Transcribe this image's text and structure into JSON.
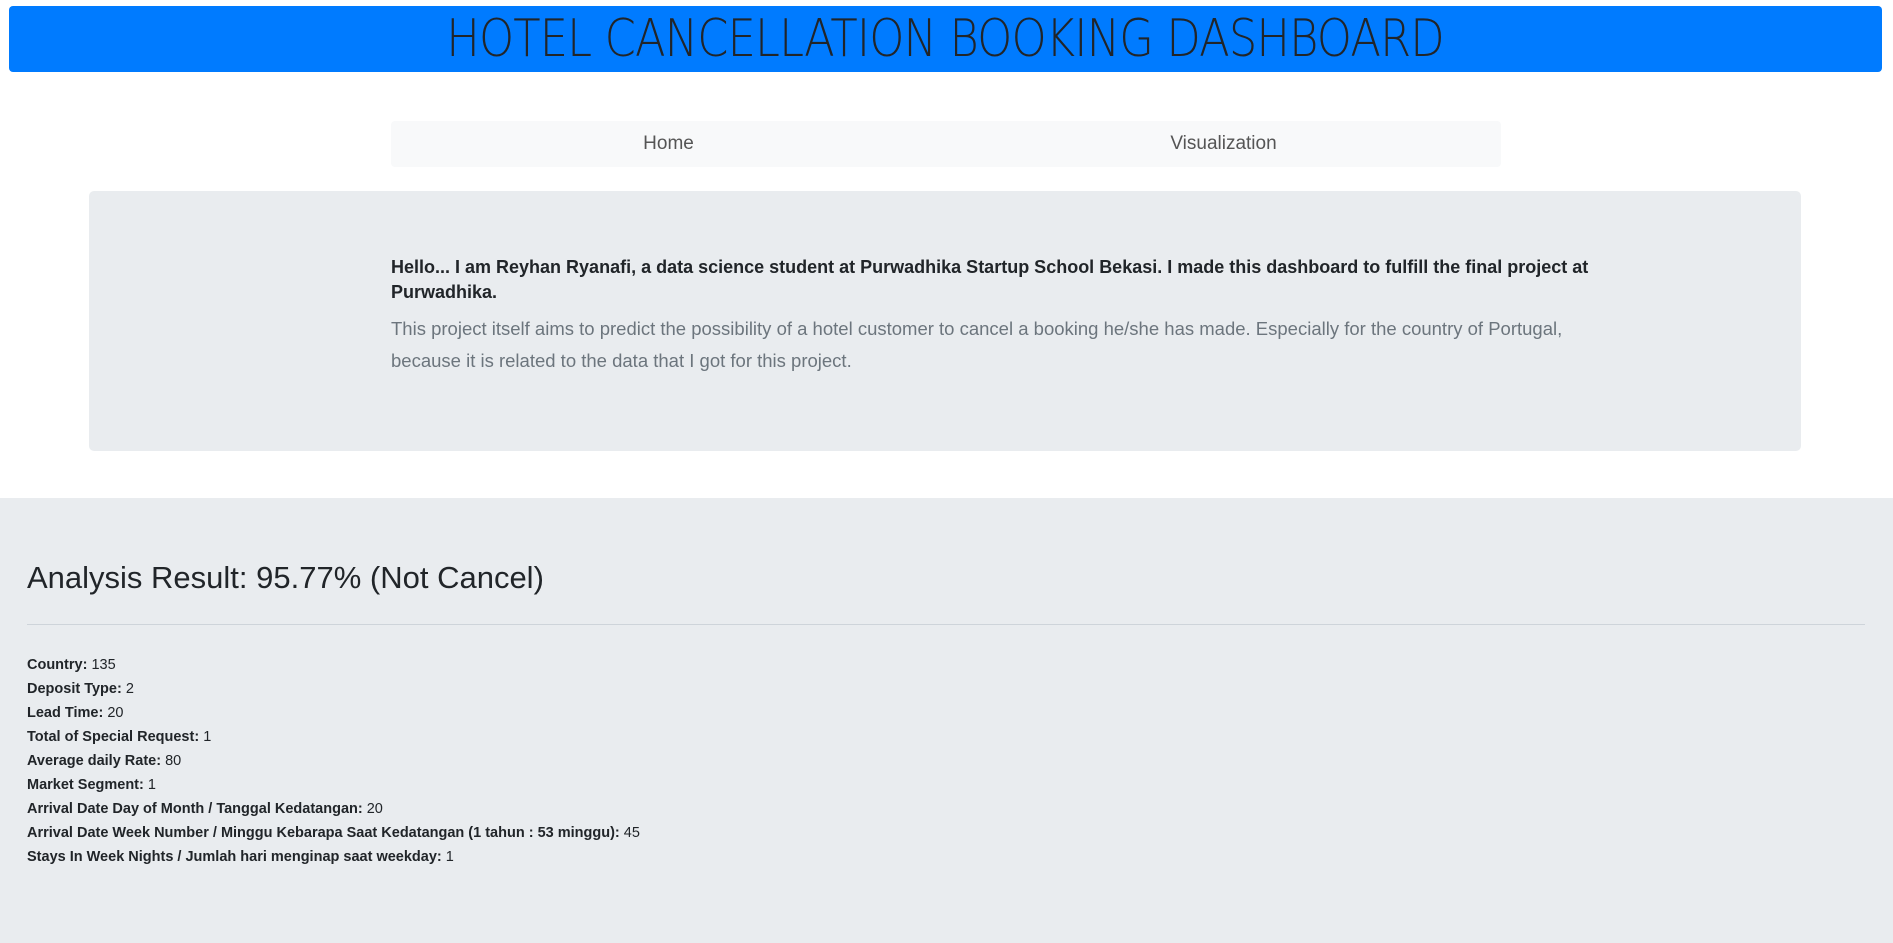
{
  "header": {
    "title": "HOTEL CANCELLATION BOOKING DASHBOARD"
  },
  "nav": {
    "items": [
      {
        "label": "Home"
      },
      {
        "label": "Visualization"
      }
    ]
  },
  "intro": {
    "heading": "Hello... I am Reyhan Ryanafi, a data science student at Purwadhika Startup School Bekasi. I made this dashboard to fulfill the final project at Purwadhika.",
    "body": "This project itself aims to predict the possibility of a hotel customer to cancel a booking he/she has made. Especially for the country of Portugal, because it is related to the data that I got for this project."
  },
  "result": {
    "title": "Analysis Result: 95.77% (Not Cancel)",
    "fields": [
      {
        "label": "Country:",
        "value": "135"
      },
      {
        "label": "Deposit Type:",
        "value": "2"
      },
      {
        "label": "Lead Time:",
        "value": "20"
      },
      {
        "label": "Total of Special Request:",
        "value": "1"
      },
      {
        "label": "Average daily Rate:",
        "value": "80"
      },
      {
        "label": "Market Segment:",
        "value": "1"
      },
      {
        "label": "Arrival Date Day of Month / Tanggal Kedatangan:",
        "value": "20"
      },
      {
        "label": "Arrival Date Week Number / Minggu Kebarapa Saat Kedatangan (1 tahun : 53 minggu):",
        "value": "45"
      },
      {
        "label": "Stays In Week Nights / Jumlah hari menginap saat weekday:",
        "value": "1"
      }
    ]
  }
}
